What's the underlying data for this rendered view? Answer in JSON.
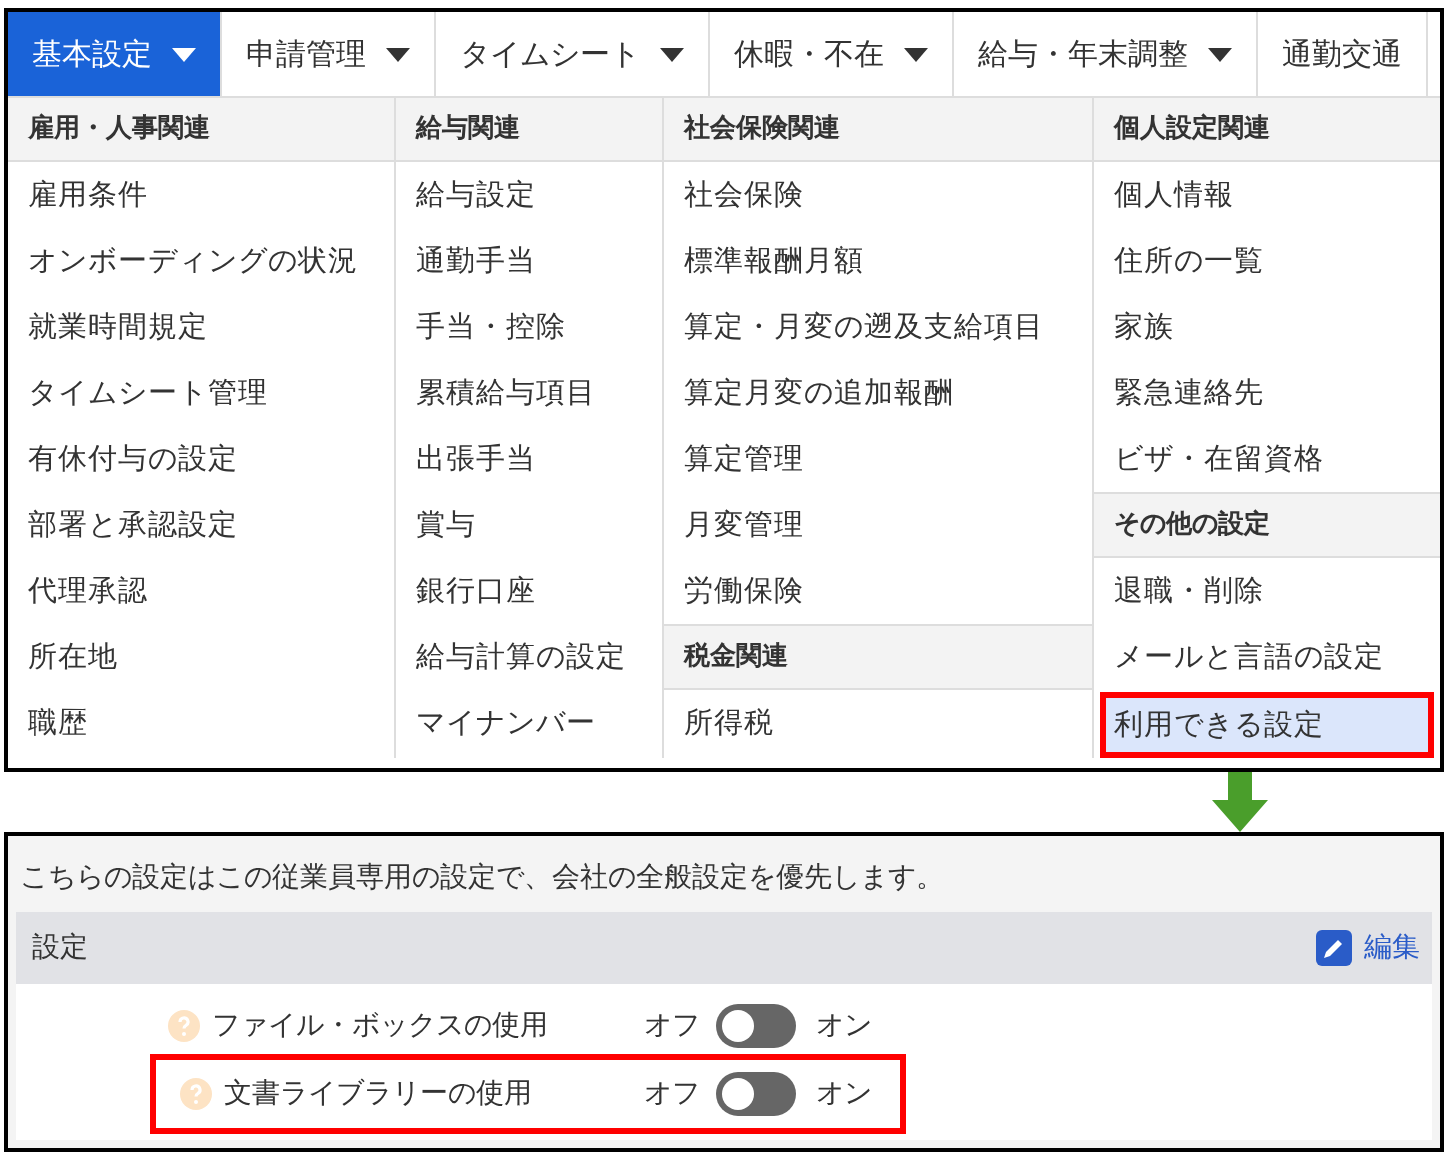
{
  "nav": {
    "tabs": [
      {
        "label": "基本設定",
        "selected": true
      },
      {
        "label": "申請管理",
        "selected": false
      },
      {
        "label": "タイムシート",
        "selected": false
      },
      {
        "label": "休暇・不在",
        "selected": false
      },
      {
        "label": "給与・年末調整",
        "selected": false
      },
      {
        "label": "通勤交通",
        "selected": false
      }
    ]
  },
  "menu": {
    "columns": [
      {
        "sections": [
          {
            "heading": "雇用・人事関連",
            "items": [
              {
                "label": "雇用条件",
                "selected": false
              },
              {
                "label": "オンボーディングの状況",
                "selected": false
              },
              {
                "label": "就業時間規定",
                "selected": false
              },
              {
                "label": "タイムシート管理",
                "selected": false
              },
              {
                "label": "有休付与の設定",
                "selected": false
              },
              {
                "label": "部署と承認設定",
                "selected": false
              },
              {
                "label": "代理承認",
                "selected": false
              },
              {
                "label": "所在地",
                "selected": false
              },
              {
                "label": "職歴",
                "selected": false
              }
            ]
          }
        ]
      },
      {
        "sections": [
          {
            "heading": "給与関連",
            "items": [
              {
                "label": "給与設定",
                "selected": false
              },
              {
                "label": "通勤手当",
                "selected": false
              },
              {
                "label": "手当・控除",
                "selected": false
              },
              {
                "label": "累積給与項目",
                "selected": false
              },
              {
                "label": "出張手当",
                "selected": false
              },
              {
                "label": "賞与",
                "selected": false
              },
              {
                "label": "銀行口座",
                "selected": false
              },
              {
                "label": "給与計算の設定",
                "selected": false
              },
              {
                "label": "マイナンバー",
                "selected": false
              }
            ]
          }
        ]
      },
      {
        "sections": [
          {
            "heading": "社会保険関連",
            "items": [
              {
                "label": "社会保険",
                "selected": false
              },
              {
                "label": "標準報酬月額",
                "selected": false
              },
              {
                "label": "算定・月変の遡及支給項目",
                "selected": false
              },
              {
                "label": "算定月変の追加報酬",
                "selected": false
              },
              {
                "label": "算定管理",
                "selected": false
              },
              {
                "label": "月変管理",
                "selected": false
              },
              {
                "label": "労働保険",
                "selected": false
              }
            ]
          },
          {
            "heading": "税金関連",
            "items": [
              {
                "label": "所得税",
                "selected": false
              }
            ]
          }
        ]
      },
      {
        "sections": [
          {
            "heading": "個人設定関連",
            "items": [
              {
                "label": "個人情報",
                "selected": false
              },
              {
                "label": "住所の一覧",
                "selected": false
              },
              {
                "label": "家族",
                "selected": false
              },
              {
                "label": "緊急連絡先",
                "selected": false
              },
              {
                "label": "ビザ・在留資格",
                "selected": false
              }
            ]
          },
          {
            "heading": "その他の設定",
            "items": [
              {
                "label": "退職・削除",
                "selected": false
              },
              {
                "label": "メールと言語の設定",
                "selected": false
              },
              {
                "label": "利用できる設定",
                "selected": true
              }
            ]
          }
        ]
      }
    ]
  },
  "settings": {
    "note": "こちらの設定はこの従業員専用の設定で、会社の全般設定を優先します。",
    "heading": "設定",
    "edit": "編集",
    "rows": [
      {
        "label": "ファイル・ボックスの使用",
        "off_label": "オフ",
        "on_label": "オン",
        "on": false,
        "highlighted": false
      },
      {
        "label": "文書ライブラリーの使用",
        "off_label": "オフ",
        "on_label": "オン",
        "on": false,
        "highlighted": true
      }
    ]
  }
}
